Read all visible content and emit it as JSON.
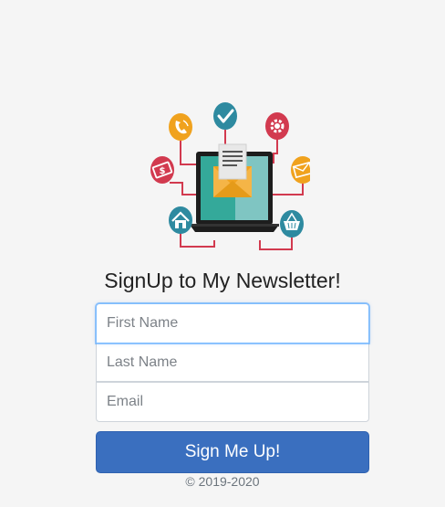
{
  "title": "SignUp to My Newsletter!",
  "form": {
    "first_name_placeholder": "First Name",
    "last_name_placeholder": "Last Name",
    "email_placeholder": "Email",
    "submit_label": "Sign Me Up!"
  },
  "footer": "© 2019-2020",
  "hero_icons": [
    "phone-icon",
    "check-icon",
    "gear-icon",
    "money-icon",
    "envelope-icon",
    "home-icon",
    "basket-icon",
    "laptop-icon"
  ],
  "colors": {
    "background": "#f5f5f5",
    "button": "#3a6fbf",
    "icon_orange": "#f0a21e",
    "icon_teal": "#2e8aa0",
    "icon_red": "#d23a4f",
    "connector": "#d23a4f"
  }
}
